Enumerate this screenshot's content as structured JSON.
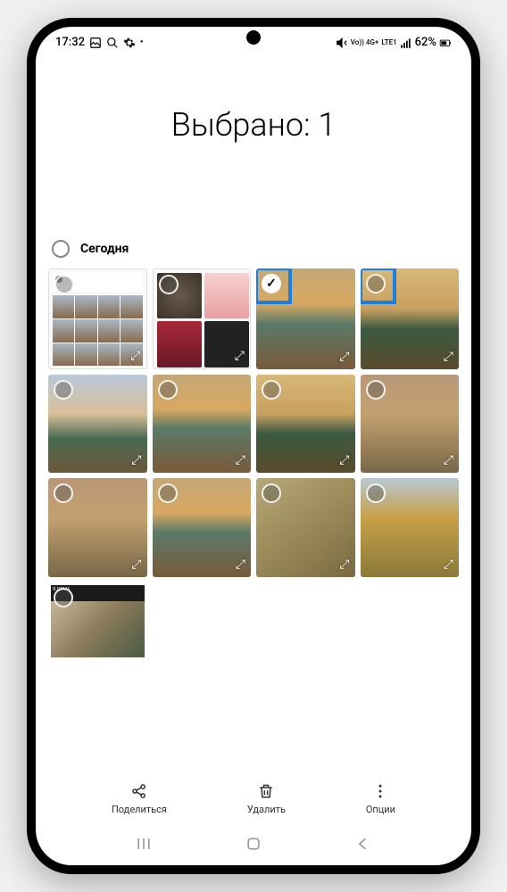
{
  "status_bar": {
    "time": "17:32",
    "network_label": "Vo)) 4G+",
    "carrier": "LTE1",
    "battery": "62%"
  },
  "header": {
    "title": "Выбрано: 1"
  },
  "section": {
    "label": "Сегодня"
  },
  "thumbnails": [
    {
      "kind": "app-grid",
      "selected": false,
      "expandable": true
    },
    {
      "kind": "app-tiles",
      "selected": false,
      "expandable": true
    },
    {
      "kind": "sky1",
      "selected": true,
      "expandable": true,
      "highlight": true
    },
    {
      "kind": "sky2",
      "selected": false,
      "expandable": true,
      "highlight": true
    },
    {
      "kind": "sky3",
      "selected": false,
      "expandable": true
    },
    {
      "kind": "sky1",
      "selected": false,
      "expandable": true
    },
    {
      "kind": "sky2",
      "selected": false,
      "expandable": true
    },
    {
      "kind": "sky4",
      "selected": false,
      "expandable": true
    },
    {
      "kind": "sky4",
      "selected": false,
      "expandable": true
    },
    {
      "kind": "sky1",
      "selected": false,
      "expandable": true
    },
    {
      "kind": "park",
      "selected": false,
      "expandable": true
    },
    {
      "kind": "tree",
      "selected": false,
      "expandable": true
    },
    {
      "kind": "social",
      "selected": false,
      "expandable": false
    }
  ],
  "actions": {
    "share": "Поделиться",
    "delete": "Удалить",
    "options": "Опции"
  }
}
